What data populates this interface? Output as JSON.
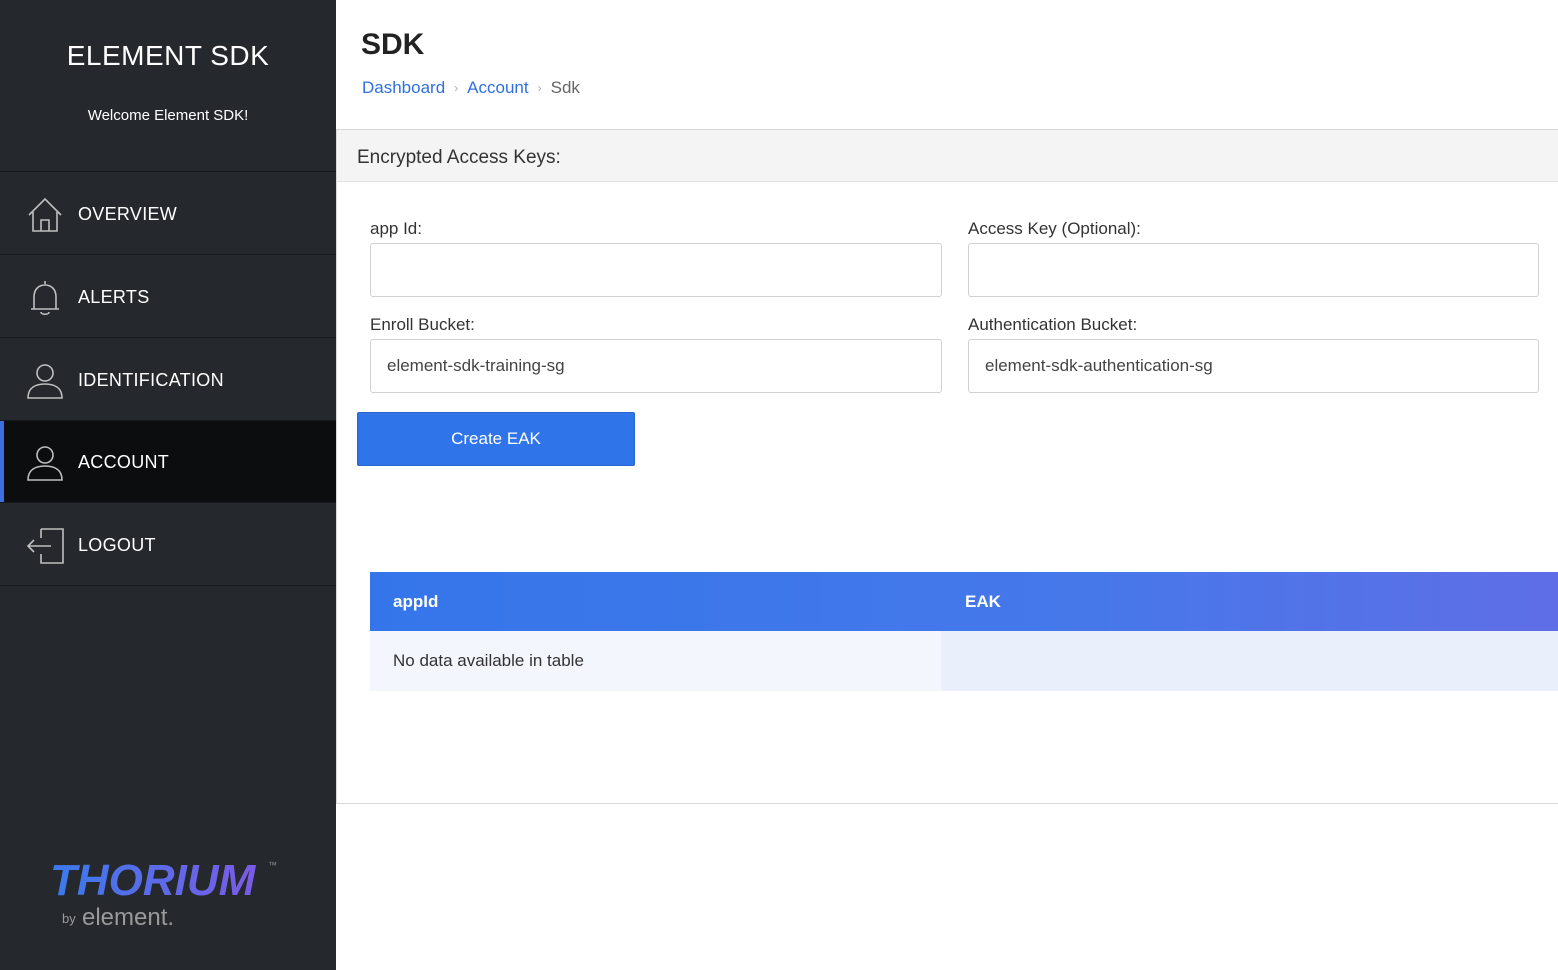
{
  "sidebar": {
    "title": "ELEMENT SDK",
    "welcome": "Welcome Element SDK!",
    "items": [
      {
        "label": "OVERVIEW",
        "icon": "home-icon"
      },
      {
        "label": "ALERTS",
        "icon": "bell-icon"
      },
      {
        "label": "IDENTIFICATION",
        "icon": "user-icon"
      },
      {
        "label": "ACCOUNT",
        "icon": "user-icon",
        "active": true
      },
      {
        "label": "LOGOUT",
        "icon": "logout-icon"
      }
    ],
    "logo": {
      "name": "THORIUM",
      "tm": "™",
      "by": "by",
      "company": "element."
    },
    "accent_color": "#3d6fe0"
  },
  "header": {
    "title": "SDK",
    "breadcrumb": {
      "items": [
        "Dashboard",
        "Account"
      ],
      "separator": "›",
      "current": "Sdk"
    }
  },
  "card": {
    "title": "Encrypted Access Keys:",
    "form": {
      "app_id": {
        "label": "app Id:",
        "value": ""
      },
      "access_key": {
        "label": "Access Key (Optional):",
        "value": ""
      },
      "enroll_bucket": {
        "label": "Enroll Bucket:",
        "value": "element-sdk-training-sg"
      },
      "auth_bucket": {
        "label": "Authentication Bucket:",
        "value": "element-sdk-authentication-sg"
      }
    },
    "create_button": "Create EAK",
    "table": {
      "columns": [
        "appId",
        "EAK"
      ],
      "empty_message": "No data available in table"
    }
  },
  "colors": {
    "primary": "#3074ea",
    "sidebar_bg": "#25282d",
    "link": "#2f6fe0"
  }
}
